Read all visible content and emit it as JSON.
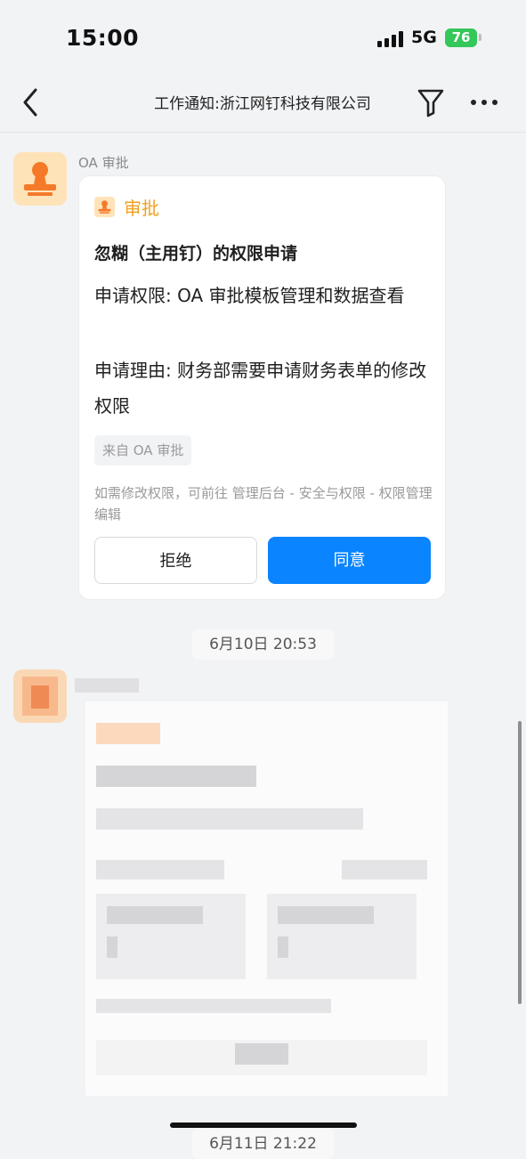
{
  "status_bar": {
    "time": "15:00",
    "network": "5G",
    "battery": "76"
  },
  "nav": {
    "title": "工作通知:浙江网钉科技有限公司"
  },
  "message1": {
    "sender": "OA 审批",
    "card": {
      "app_name": "审批",
      "title": "忽糊（主用钉）的权限申请",
      "field1": "申请权限: OA 审批模板管理和数据查看",
      "field2": "申请理由: 财务部需要申请财务表单的修改权限",
      "source": "来自 OA 审批",
      "hint": "如需修改权限，可前往 管理后台 - 安全与权限 - 权限管理 编辑",
      "reject_label": "拒绝",
      "agree_label": "同意"
    }
  },
  "divider1": "6月10日 20:53",
  "divider2": "6月11日 21:22",
  "colors": {
    "accent": "#0a84ff",
    "approval_orange": "#f0a020",
    "battery_green": "#34c759"
  }
}
